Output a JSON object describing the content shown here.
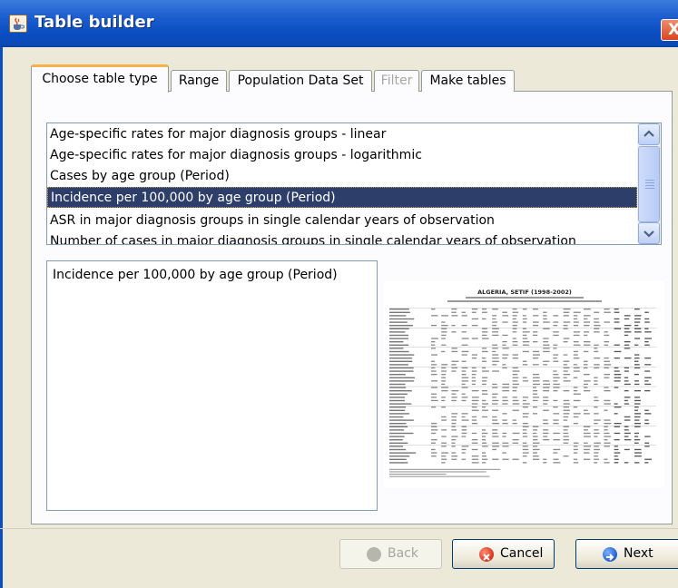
{
  "window": {
    "title": "Table builder",
    "close_symbol": "X",
    "title_icon": "java-coffee-icon",
    "close_icon": "close-icon"
  },
  "tabs": [
    {
      "label": "Choose table type",
      "active": true,
      "enabled": true
    },
    {
      "label": "Range",
      "active": false,
      "enabled": true
    },
    {
      "label": "Population Data Set",
      "active": false,
      "enabled": true
    },
    {
      "label": "Filter",
      "active": false,
      "enabled": false
    },
    {
      "label": "Make tables",
      "active": false,
      "enabled": true
    }
  ],
  "table_types": {
    "items": [
      "Age-specific rates for major diagnosis groups - linear",
      "Age-specific rates for major diagnosis groups - logarithmic",
      "Cases by age group (Period)",
      "Incidence per 100,000 by age group (Period)",
      "ASR in major diagnosis groups in single calendar years of observation",
      "Number of cases in major diagnosis groups in single calendar years of observation"
    ],
    "selected_index": 3
  },
  "description": {
    "text": "Incidence per 100,000 by age group (Period)"
  },
  "preview": {
    "title": "ALGERIA, SETIF (1998-2002)",
    "icon": "table-preview-thumbnail"
  },
  "buttons": {
    "back": {
      "label": "Back",
      "enabled": false,
      "icon": "back-arrow-icon"
    },
    "cancel": {
      "label": "Cancel",
      "enabled": true,
      "icon": "cancel-icon"
    },
    "next": {
      "label": "Next",
      "enabled": true,
      "icon": "next-arrow-icon"
    }
  },
  "colors": {
    "titlebar": "#0b4fc4",
    "selection": "#2d3e6b",
    "active_tab_accent": "#f3b34a",
    "cancel_icon": "#d8321e",
    "next_icon": "#1f5fd0"
  }
}
